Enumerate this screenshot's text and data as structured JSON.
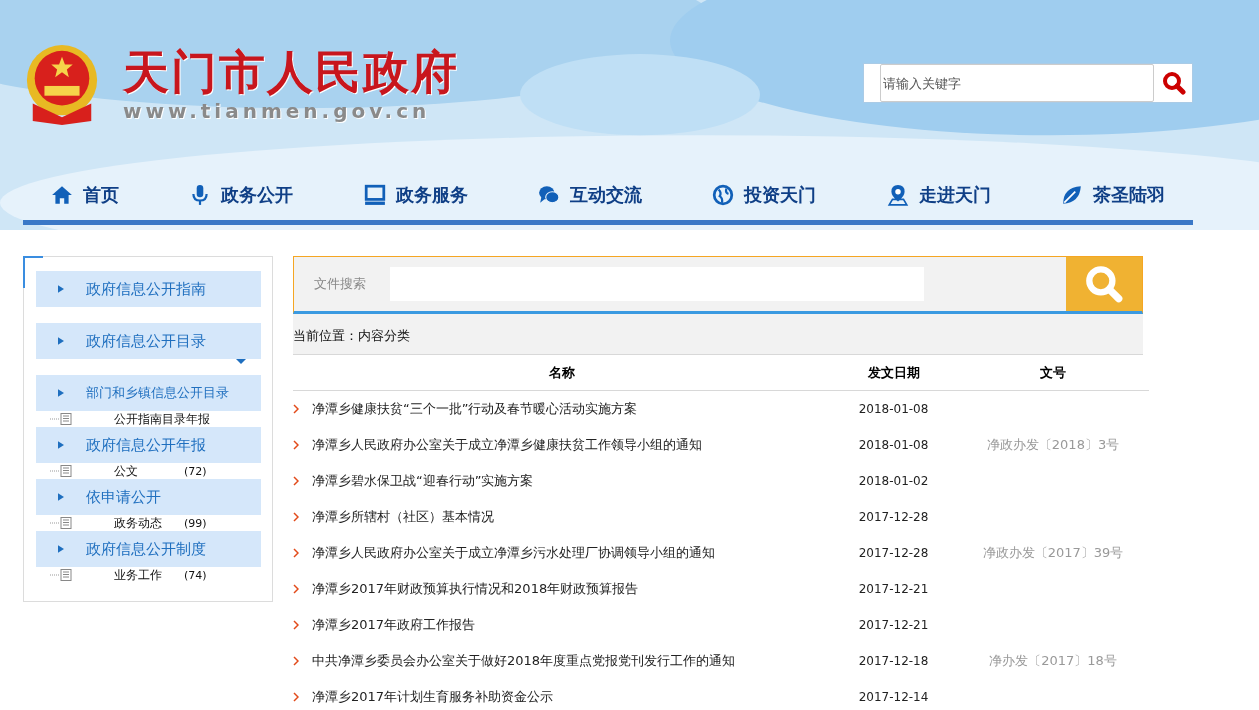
{
  "header": {
    "title": "天门市人民政府",
    "url": "www.tianmen.gov.cn",
    "search": {
      "placeholder": "请输入关键字"
    }
  },
  "nav": [
    {
      "label": "首页",
      "kind": "home"
    },
    {
      "label": "政务公开",
      "kind": "mic"
    },
    {
      "label": "政务服务",
      "kind": "monitor"
    },
    {
      "label": "互动交流",
      "kind": "chat"
    },
    {
      "label": "投资天门",
      "kind": "globe"
    },
    {
      "label": "走进天门",
      "kind": "pin"
    },
    {
      "label": "茶圣陆羽",
      "kind": "leaf"
    }
  ],
  "sidebar": {
    "items": [
      {
        "kind": "menu",
        "label": "政府信息公开指南"
      },
      {
        "kind": "menu",
        "label": "政府信息公开目录"
      },
      {
        "kind": "caret"
      },
      {
        "kind": "menu",
        "label": "部门和乡镇信息公开目录"
      },
      {
        "kind": "tree",
        "label": "公开指南目录年报"
      },
      {
        "kind": "menu",
        "label": "政府信息公开年报"
      },
      {
        "kind": "tree",
        "label": "公文",
        "count": "(72)"
      },
      {
        "kind": "menu",
        "label": "依申请公开"
      },
      {
        "kind": "tree",
        "label": "政务动态",
        "count": "(99)"
      },
      {
        "kind": "menu",
        "label": "政府信息公开制度"
      },
      {
        "kind": "tree",
        "label": "业务工作",
        "count": "(74)"
      }
    ]
  },
  "file_search": {
    "label": "文件搜索"
  },
  "breadcrumb": "当前位置：内容分类",
  "table": {
    "columns": [
      "名称",
      "发文日期",
      "文号"
    ],
    "rows": [
      {
        "title": "净潭乡健康扶贫“三个一批”行动及春节暖心活动实施方案",
        "date": "2018-01-08"
      },
      {
        "title": "净潭乡人民政府办公室关于成立净潭乡健康扶贫工作领导小组的通知",
        "date": "2018-01-08",
        "number": "净政办发〔2018〕3号"
      },
      {
        "title": "净潭乡碧水保卫战“迎春行动”实施方案",
        "date": "2018-01-02"
      },
      {
        "title": "净潭乡所辖村（社区）基本情况",
        "date": "2017-12-28"
      },
      {
        "title": "净潭乡人民政府办公室关于成立净潭乡污水处理厂协调领导小组的通知",
        "date": "2017-12-28",
        "number": "净政办发〔2017〕39号"
      },
      {
        "title": "净潭乡2017年财政预算执行情况和2018年财政预算报告",
        "date": "2017-12-21"
      },
      {
        "title": "净潭乡2017年政府工作报告",
        "date": "2017-12-21"
      },
      {
        "title": "中共净潭乡委员会办公室关于做好2018年度重点党报党刊发行工作的通知",
        "date": "2017-12-18",
        "number": "净办发〔2017〕18号"
      },
      {
        "title": "净潭乡2017年计划生育服务补助资金公示",
        "date": "2017-12-14"
      }
    ]
  }
}
